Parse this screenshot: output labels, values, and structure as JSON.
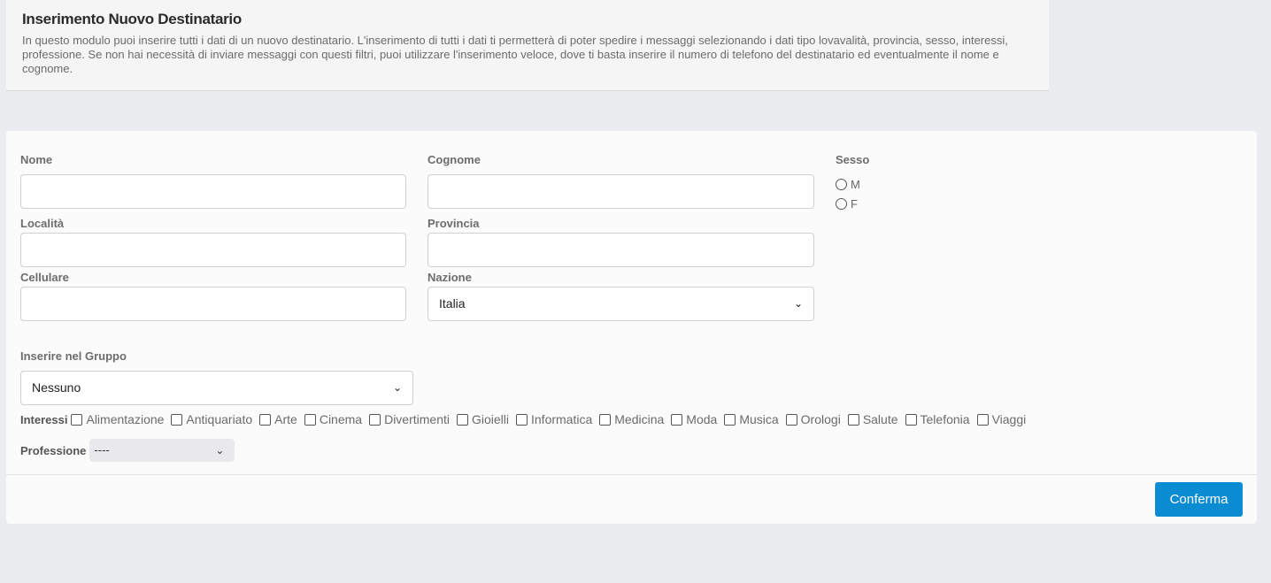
{
  "header": {
    "title": "Inserimento Nuovo Destinatario",
    "description": "In questo modulo puoi inserire tutti i dati di un nuovo destinatario. L'inserimento di tutti i dati ti permetterà di poter spedire i messaggi selezionando i dati tipo lovavalità, provincia, sesso, interessi, professione. Se non hai necessità di inviare messaggi con questi filtri, puoi utilizzare l'inserimento veloce, dove ti basta inserire il numero di telefono del destinatario ed eventualmente il nome e cognome."
  },
  "form": {
    "nome_label": "Nome",
    "cognome_label": "Cognome",
    "sesso_label": "Sesso",
    "sesso_options": [
      "M",
      "F"
    ],
    "localita_label": "Località",
    "provincia_label": "Provincia",
    "cellulare_label": "Cellulare",
    "nazione_label": "Nazione",
    "nazione_value": "Italia",
    "gruppo_label": "Inserire nel Gruppo",
    "gruppo_value": "Nessuno",
    "interessi_label": "Interessi",
    "interessi": [
      "Alimentazione",
      "Antiquariato",
      "Arte",
      "Cinema",
      "Divertimenti",
      "Gioielli",
      "Informatica",
      "Medicina",
      "Moda",
      "Musica",
      "Orologi",
      "Salute",
      "Telefonia",
      "Viaggi"
    ],
    "professione_label": "Professione",
    "professione_value": "----",
    "confirm_label": "Conferma"
  },
  "icons": {
    "dropdown": "chevron-down-icon"
  },
  "colors": {
    "primary_button": "#0b8bd1"
  }
}
